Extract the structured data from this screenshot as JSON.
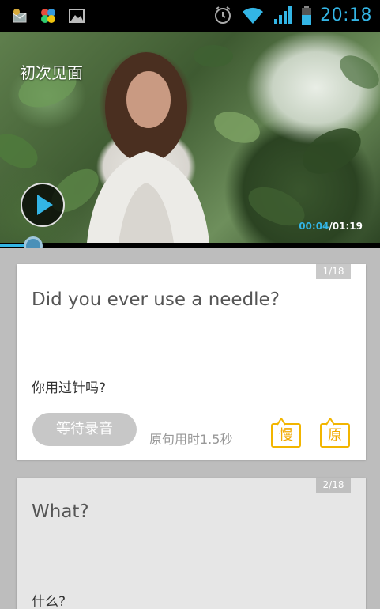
{
  "status_bar": {
    "time": "20:18",
    "icons": [
      "email-notification-icon",
      "app-notification-icon",
      "image-notification-icon",
      "alarm-icon",
      "wifi-icon",
      "signal-icon",
      "battery-icon"
    ]
  },
  "video": {
    "title": "初次见面",
    "current_time": "00:04",
    "separator": "/",
    "total_time": "01:19",
    "progress": 0.05,
    "accent_color": "#33b5e5"
  },
  "cards": [
    {
      "counter": "1/18",
      "english": "Did you ever use a needle?",
      "chinese": "你用过针吗?",
      "record_label": "等待录音",
      "duration_label": "原句用时1.5秒",
      "slow_label": "慢",
      "original_label": "原"
    },
    {
      "counter": "2/18",
      "english": "What?",
      "chinese": "什么?"
    }
  ],
  "colors": {
    "button_border": "#f2b500",
    "record_button": "#c7c7c7"
  }
}
